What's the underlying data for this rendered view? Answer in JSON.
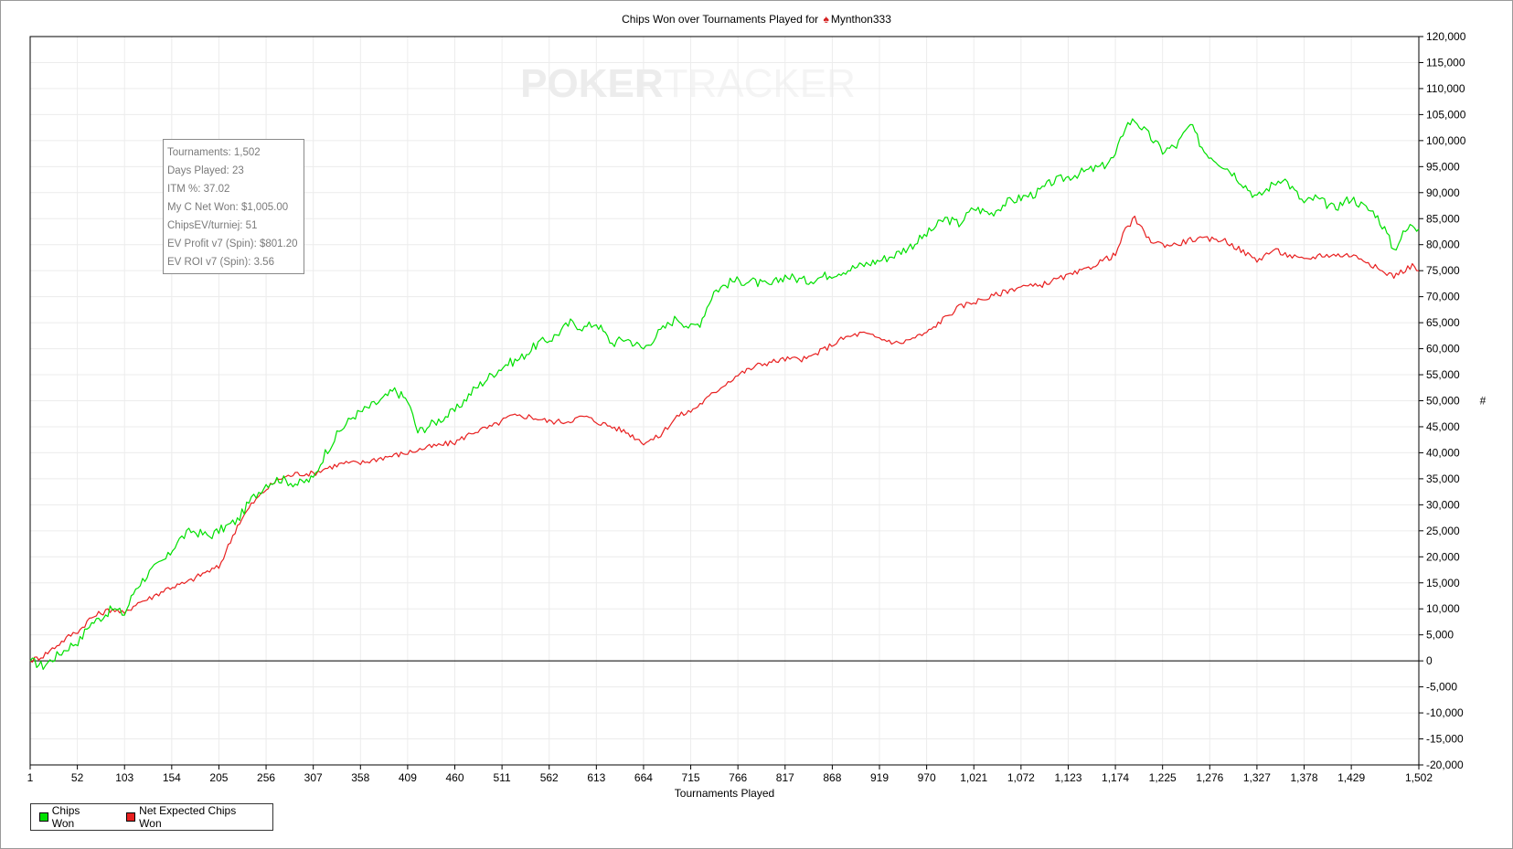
{
  "title_prefix": "Chips Won over Tournaments Played for",
  "player": "Mynthon333",
  "watermark": {
    "part1": "POKER",
    "part2": "TRACKER"
  },
  "stats": [
    "Tournaments: 1,502",
    "Days Played: 23",
    "ITM %: 37.02",
    "My C Net Won: $1,005.00",
    "ChipsEV/turniej: 51",
    "EV Profit v7 (Spin): $801.20",
    "EV ROI v7 (Spin): 3.56"
  ],
  "colors": {
    "chips_won": "#00e000",
    "net_expected": "#e82020"
  },
  "chart_data": {
    "type": "line",
    "title": "Chips Won over Tournaments Played for Mynthon333",
    "xlabel": "Tournaments Played",
    "ylabel": "#",
    "xlim": [
      1,
      1502
    ],
    "ylim": [
      -20000,
      120000
    ],
    "x_ticks": [
      1,
      52,
      103,
      154,
      205,
      256,
      307,
      358,
      409,
      460,
      511,
      562,
      613,
      664,
      715,
      766,
      817,
      868,
      919,
      970,
      1021,
      1072,
      1123,
      1174,
      1225,
      1276,
      1327,
      1378,
      1429,
      1502
    ],
    "x_tick_labels": [
      "1",
      "52",
      "103",
      "154",
      "205",
      "256",
      "307",
      "358",
      "409",
      "460",
      "511",
      "562",
      "613",
      "664",
      "715",
      "766",
      "817",
      "868",
      "919",
      "970",
      "1,021",
      "1,072",
      "1,123",
      "1,174",
      "1,225",
      "1,276",
      "1,327",
      "1,378",
      "1,429",
      "1,502"
    ],
    "y_ticks": [
      -20000,
      -15000,
      -10000,
      -5000,
      0,
      5000,
      10000,
      15000,
      20000,
      25000,
      30000,
      35000,
      40000,
      45000,
      50000,
      55000,
      60000,
      65000,
      70000,
      75000,
      80000,
      85000,
      90000,
      95000,
      100000,
      105000,
      110000,
      115000,
      120000
    ],
    "y_tick_labels": [
      "-20,000",
      "-15,000",
      "-10,000",
      "-5,000",
      "0",
      "5,000",
      "10,000",
      "15,000",
      "20,000",
      "25,000",
      "30,000",
      "35,000",
      "40,000",
      "45,000",
      "50,000",
      "55,000",
      "60,000",
      "65,000",
      "70,000",
      "75,000",
      "80,000",
      "85,000",
      "90,000",
      "95,000",
      "100,000",
      "105,000",
      "110,000",
      "115,000",
      "120,000"
    ],
    "grid": true,
    "legend": "bottom-left",
    "series": [
      {
        "name": "Chips Won",
        "x": [
          1,
          15,
          30,
          45,
          55,
          65,
          75,
          90,
          103,
          115,
          130,
          150,
          160,
          175,
          195,
          205,
          225,
          240,
          256,
          270,
          290,
          307,
          320,
          335,
          350,
          360,
          380,
          395,
          409,
          420,
          440,
          460,
          480,
          500,
          515,
          530,
          550,
          565,
          585,
          600,
          613,
          630,
          645,
          664,
          680,
          700,
          715,
          725,
          740,
          760,
          780,
          800,
          817,
          840,
          860,
          880,
          900,
          919,
          935,
          955,
          970,
          990,
          1005,
          1021,
          1040,
          1055,
          1072,
          1090,
          1105,
          1123,
          1140,
          1160,
          1174,
          1185,
          1195,
          1210,
          1225,
          1240,
          1255,
          1270,
          1285,
          1300,
          1327,
          1340,
          1355,
          1378,
          1390,
          1410,
          1429,
          1445,
          1455,
          1465,
          1475,
          1485,
          1495,
          1502
        ],
        "y": [
          0,
          -1000,
          1000,
          3000,
          4000,
          7000,
          8000,
          10000,
          9000,
          14000,
          17000,
          20000,
          23000,
          25000,
          24000,
          25000,
          27000,
          31000,
          34000,
          35000,
          34000,
          35000,
          40000,
          44000,
          47000,
          48000,
          50000,
          52000,
          50000,
          44000,
          46000,
          48000,
          52000,
          55000,
          57000,
          58000,
          61000,
          62000,
          65000,
          64000,
          65000,
          61000,
          62000,
          60000,
          63000,
          66000,
          64000,
          65000,
          71000,
          73000,
          73000,
          72000,
          74000,
          73000,
          74000,
          75000,
          76000,
          77000,
          78000,
          80000,
          82000,
          85000,
          84000,
          87000,
          86000,
          88000,
          89000,
          90000,
          92000,
          93000,
          94000,
          95000,
          97000,
          103000,
          104000,
          101000,
          98000,
          99000,
          103000,
          98000,
          96000,
          94000,
          89000,
          91000,
          93000,
          88000,
          89000,
          87000,
          89000,
          87000,
          86000,
          83000,
          79000,
          82000,
          84000,
          83000
        ]
      },
      {
        "name": "Net Expected Chips Won",
        "x": [
          1,
          15,
          30,
          45,
          55,
          65,
          75,
          90,
          103,
          115,
          130,
          150,
          170,
          190,
          205,
          215,
          225,
          240,
          256,
          270,
          290,
          307,
          320,
          340,
          358,
          380,
          409,
          430,
          460,
          480,
          500,
          520,
          540,
          562,
          580,
          600,
          613,
          630,
          645,
          664,
          680,
          700,
          715,
          730,
          750,
          766,
          790,
          817,
          840,
          860,
          880,
          900,
          919,
          940,
          955,
          970,
          990,
          1005,
          1021,
          1040,
          1055,
          1072,
          1090,
          1105,
          1123,
          1140,
          1160,
          1174,
          1185,
          1195,
          1210,
          1225,
          1240,
          1255,
          1276,
          1290,
          1300,
          1327,
          1345,
          1360,
          1378,
          1395,
          1410,
          1429,
          1445,
          1460,
          1475,
          1485,
          1495,
          1502
        ],
        "y": [
          0,
          1000,
          3000,
          5000,
          6000,
          8000,
          9000,
          10000,
          9000,
          11000,
          12000,
          14000,
          15000,
          17000,
          18000,
          22000,
          26000,
          30000,
          33000,
          35000,
          36000,
          36000,
          37000,
          38000,
          38000,
          39000,
          40000,
          41000,
          42000,
          44000,
          45000,
          47000,
          47000,
          46000,
          46000,
          47000,
          46000,
          45000,
          44000,
          42000,
          43000,
          47000,
          48000,
          50000,
          53000,
          55000,
          57000,
          58000,
          58000,
          60000,
          62000,
          63000,
          62000,
          61000,
          62000,
          63000,
          66000,
          68000,
          69000,
          70000,
          71000,
          72000,
          72000,
          73000,
          74000,
          75000,
          77000,
          78000,
          83000,
          85000,
          81000,
          80000,
          80000,
          81000,
          81000,
          81000,
          80000,
          77000,
          79000,
          78000,
          77000,
          78000,
          78000,
          78000,
          77000,
          75000,
          74000,
          75000,
          76000,
          75000
        ]
      }
    ]
  }
}
